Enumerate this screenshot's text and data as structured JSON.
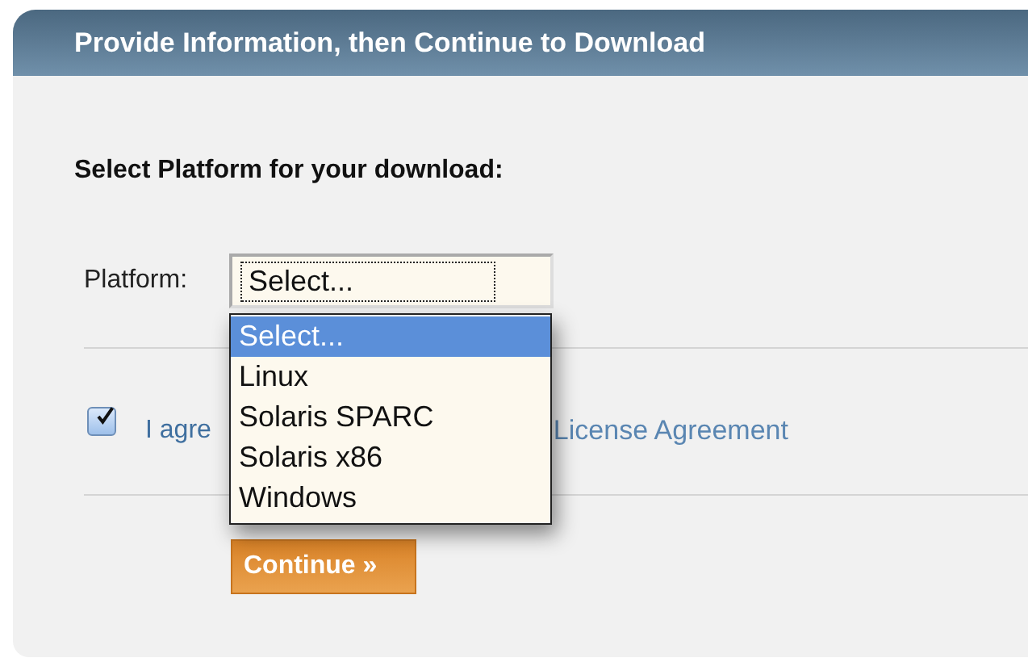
{
  "panel": {
    "title": "Provide Information, then Continue to Download"
  },
  "heading": "Select Platform for your download:",
  "platform": {
    "label": "Platform:",
    "value": "Select...",
    "expanded": true,
    "options": [
      {
        "label": "Select...",
        "selected": true
      },
      {
        "label": "Linux",
        "selected": false
      },
      {
        "label": "Solaris SPARC",
        "selected": false
      },
      {
        "label": "Solaris x86",
        "selected": false
      },
      {
        "label": "Windows",
        "selected": false
      }
    ]
  },
  "agreement": {
    "checked": true,
    "text": "I agre",
    "link": "License Agreement"
  },
  "button": "Continue »"
}
